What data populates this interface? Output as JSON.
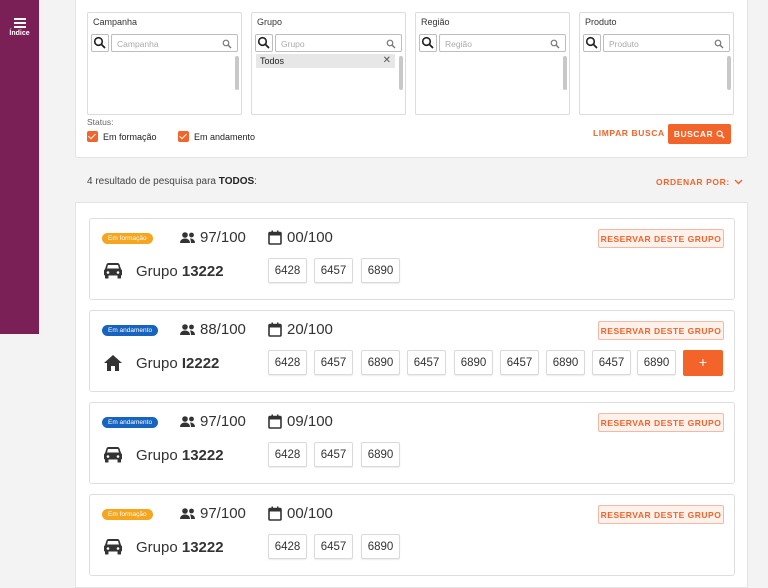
{
  "sidebar": {
    "menu_label": "Índice"
  },
  "filters": [
    {
      "title": "Campanha",
      "placeholder": "Campanha",
      "selected": ""
    },
    {
      "title": "Grupo",
      "placeholder": "Grupo",
      "selected": "Todos"
    },
    {
      "title": "Região",
      "placeholder": "Região",
      "selected": ""
    },
    {
      "title": "Produto",
      "placeholder": "Produto",
      "selected": ""
    }
  ],
  "status": {
    "label": "Status:",
    "options": [
      {
        "label": "Em formação",
        "checked": true
      },
      {
        "label": "Em andamento",
        "checked": true
      }
    ]
  },
  "actions": {
    "clear": "LIMPAR BUSCA",
    "search": "BUSCAR"
  },
  "results": {
    "summary_prefix": "4 resultado de pesquisa para ",
    "summary_query": "TODOS",
    "summary_suffix": ":",
    "sort_label": "ORDENAR POR:"
  },
  "cards": [
    {
      "status": "Em formação",
      "status_color": "#f6a51f",
      "people": "97/100",
      "date": "00/100",
      "reserve": "RESERVAR DESTE GRUPO",
      "icon": "car-icon",
      "group_prefix": "Grupo ",
      "group_number": "13222",
      "codes": [
        "6428",
        "6457",
        "6890"
      ]
    },
    {
      "status": "Em andamento",
      "status_color": "#1763c0",
      "people": "88/100",
      "date": "20/100",
      "reserve": "RESERVAR DESTE GRUPO",
      "icon": "home-icon",
      "group_prefix": "Grupo ",
      "group_number": "I2222",
      "codes": [
        "6428",
        "6457",
        "6890",
        "6457",
        "6890",
        "6457",
        "6890",
        "6457",
        "6890"
      ],
      "more": "+"
    },
    {
      "status": "Em andamento",
      "status_color": "#1763c0",
      "people": "97/100",
      "date": "09/100",
      "reserve": "RESERVAR DESTE GRUPO",
      "icon": "car-icon",
      "group_prefix": "Grupo ",
      "group_number": "13222",
      "codes": [
        "6428",
        "6457",
        "6890"
      ]
    },
    {
      "status": "Em formação",
      "status_color": "#f6a51f",
      "people": "97/100",
      "date": "00/100",
      "reserve": "RESERVAR DESTE GRUPO",
      "icon": "car-icon",
      "group_prefix": "Grupo ",
      "group_number": "13222",
      "codes": [
        "6428",
        "6457",
        "6890"
      ]
    }
  ],
  "colors": {
    "accent": "#f2642a",
    "sidebar": "#7b1f57",
    "badge_formacao": "#f6a51f",
    "badge_andamento": "#1763c0"
  }
}
